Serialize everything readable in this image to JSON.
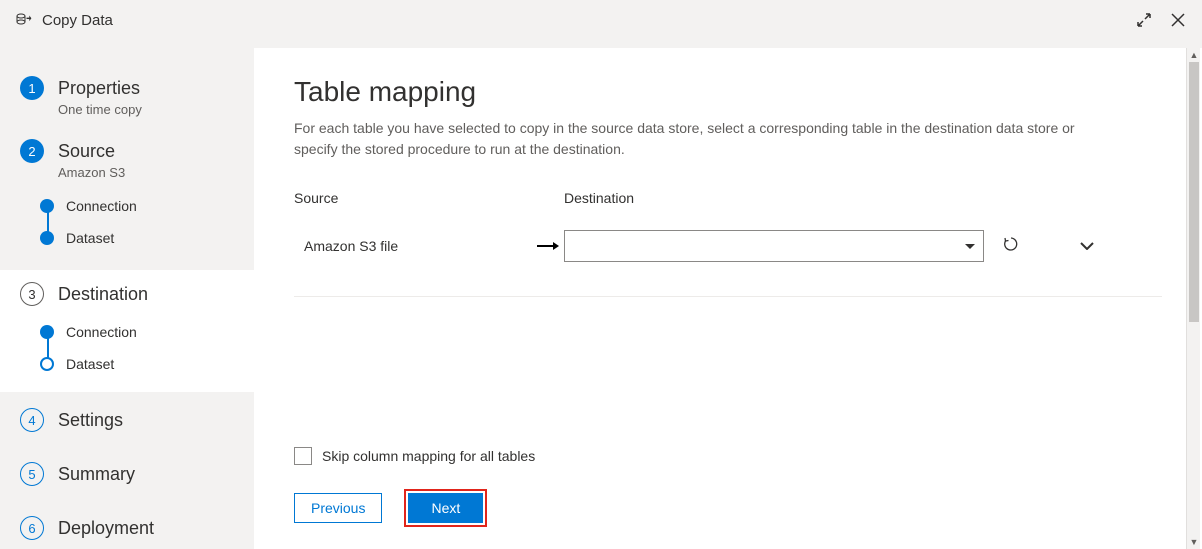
{
  "titlebar": {
    "title": "Copy Data"
  },
  "sidebar": {
    "steps": [
      {
        "num": "1",
        "title": "Properties",
        "sub": "One time copy"
      },
      {
        "num": "2",
        "title": "Source",
        "sub": "Amazon S3",
        "substeps": [
          "Connection",
          "Dataset"
        ]
      },
      {
        "num": "3",
        "title": "Destination",
        "substeps": [
          "Connection",
          "Dataset"
        ]
      },
      {
        "num": "4",
        "title": "Settings"
      },
      {
        "num": "5",
        "title": "Summary"
      },
      {
        "num": "6",
        "title": "Deployment"
      }
    ]
  },
  "main": {
    "title": "Table mapping",
    "description": "For each table you have selected to copy in the source data store, select a corresponding table in the destination data store or specify the stored procedure to run at the destination.",
    "columns": {
      "source": "Source",
      "destination": "Destination"
    },
    "row": {
      "source": "Amazon S3 file",
      "destination": ""
    },
    "skip_label": "Skip column mapping for all tables",
    "buttons": {
      "previous": "Previous",
      "next": "Next"
    }
  }
}
